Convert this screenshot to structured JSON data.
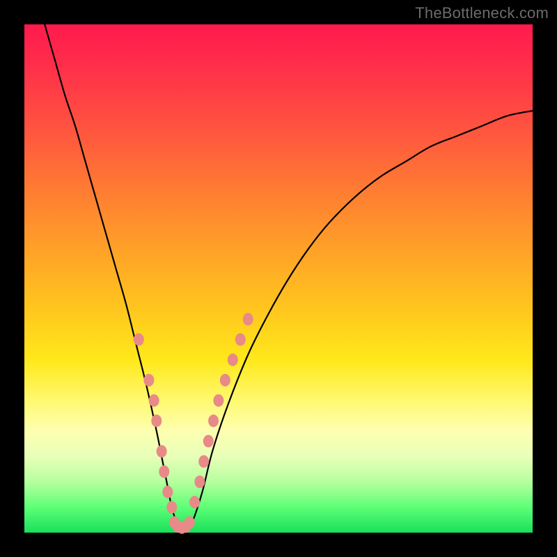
{
  "watermark": {
    "text": "TheBottleneck.com"
  },
  "chart_data": {
    "type": "line",
    "title": "",
    "xlabel": "",
    "ylabel": "",
    "xlim": [
      0,
      100
    ],
    "ylim": [
      0,
      100
    ],
    "grid": false,
    "legend": false,
    "series": [
      {
        "name": "curve",
        "x": [
          4,
          6,
          8,
          10,
          12,
          14,
          16,
          18,
          20,
          22,
          24,
          26,
          27,
          28,
          29,
          30,
          31,
          32,
          33,
          35,
          37,
          40,
          44,
          48,
          52,
          56,
          60,
          65,
          70,
          75,
          80,
          85,
          90,
          95,
          100
        ],
        "y": [
          100,
          93,
          86,
          80,
          73,
          66,
          59,
          52,
          45,
          37,
          29,
          20,
          15,
          10,
          5,
          2,
          1,
          1,
          2,
          8,
          16,
          25,
          35,
          43,
          50,
          56,
          61,
          66,
          70,
          73,
          76,
          78,
          80,
          82,
          83
        ],
        "color": "#000000"
      },
      {
        "name": "markers-left",
        "type": "scatter",
        "x": [
          22.5,
          24.5,
          25.5,
          26.0,
          27.0,
          27.5,
          28.2,
          29.0
        ],
        "y": [
          38,
          30,
          26,
          22,
          16,
          12,
          8,
          5
        ],
        "color": "#e88a87"
      },
      {
        "name": "markers-bottom",
        "type": "scatter",
        "x": [
          29.5,
          30.2,
          31.0,
          31.8,
          32.5
        ],
        "y": [
          2,
          1.2,
          1,
          1.2,
          2
        ],
        "color": "#e88a87"
      },
      {
        "name": "markers-right",
        "type": "scatter",
        "x": [
          33.5,
          34.5,
          35.3,
          36.2,
          37.2,
          38.2,
          39.5,
          41.0,
          42.5,
          44.0
        ],
        "y": [
          6,
          10,
          14,
          18,
          22,
          26,
          30,
          34,
          38,
          42
        ],
        "color": "#e88a87"
      }
    ]
  }
}
